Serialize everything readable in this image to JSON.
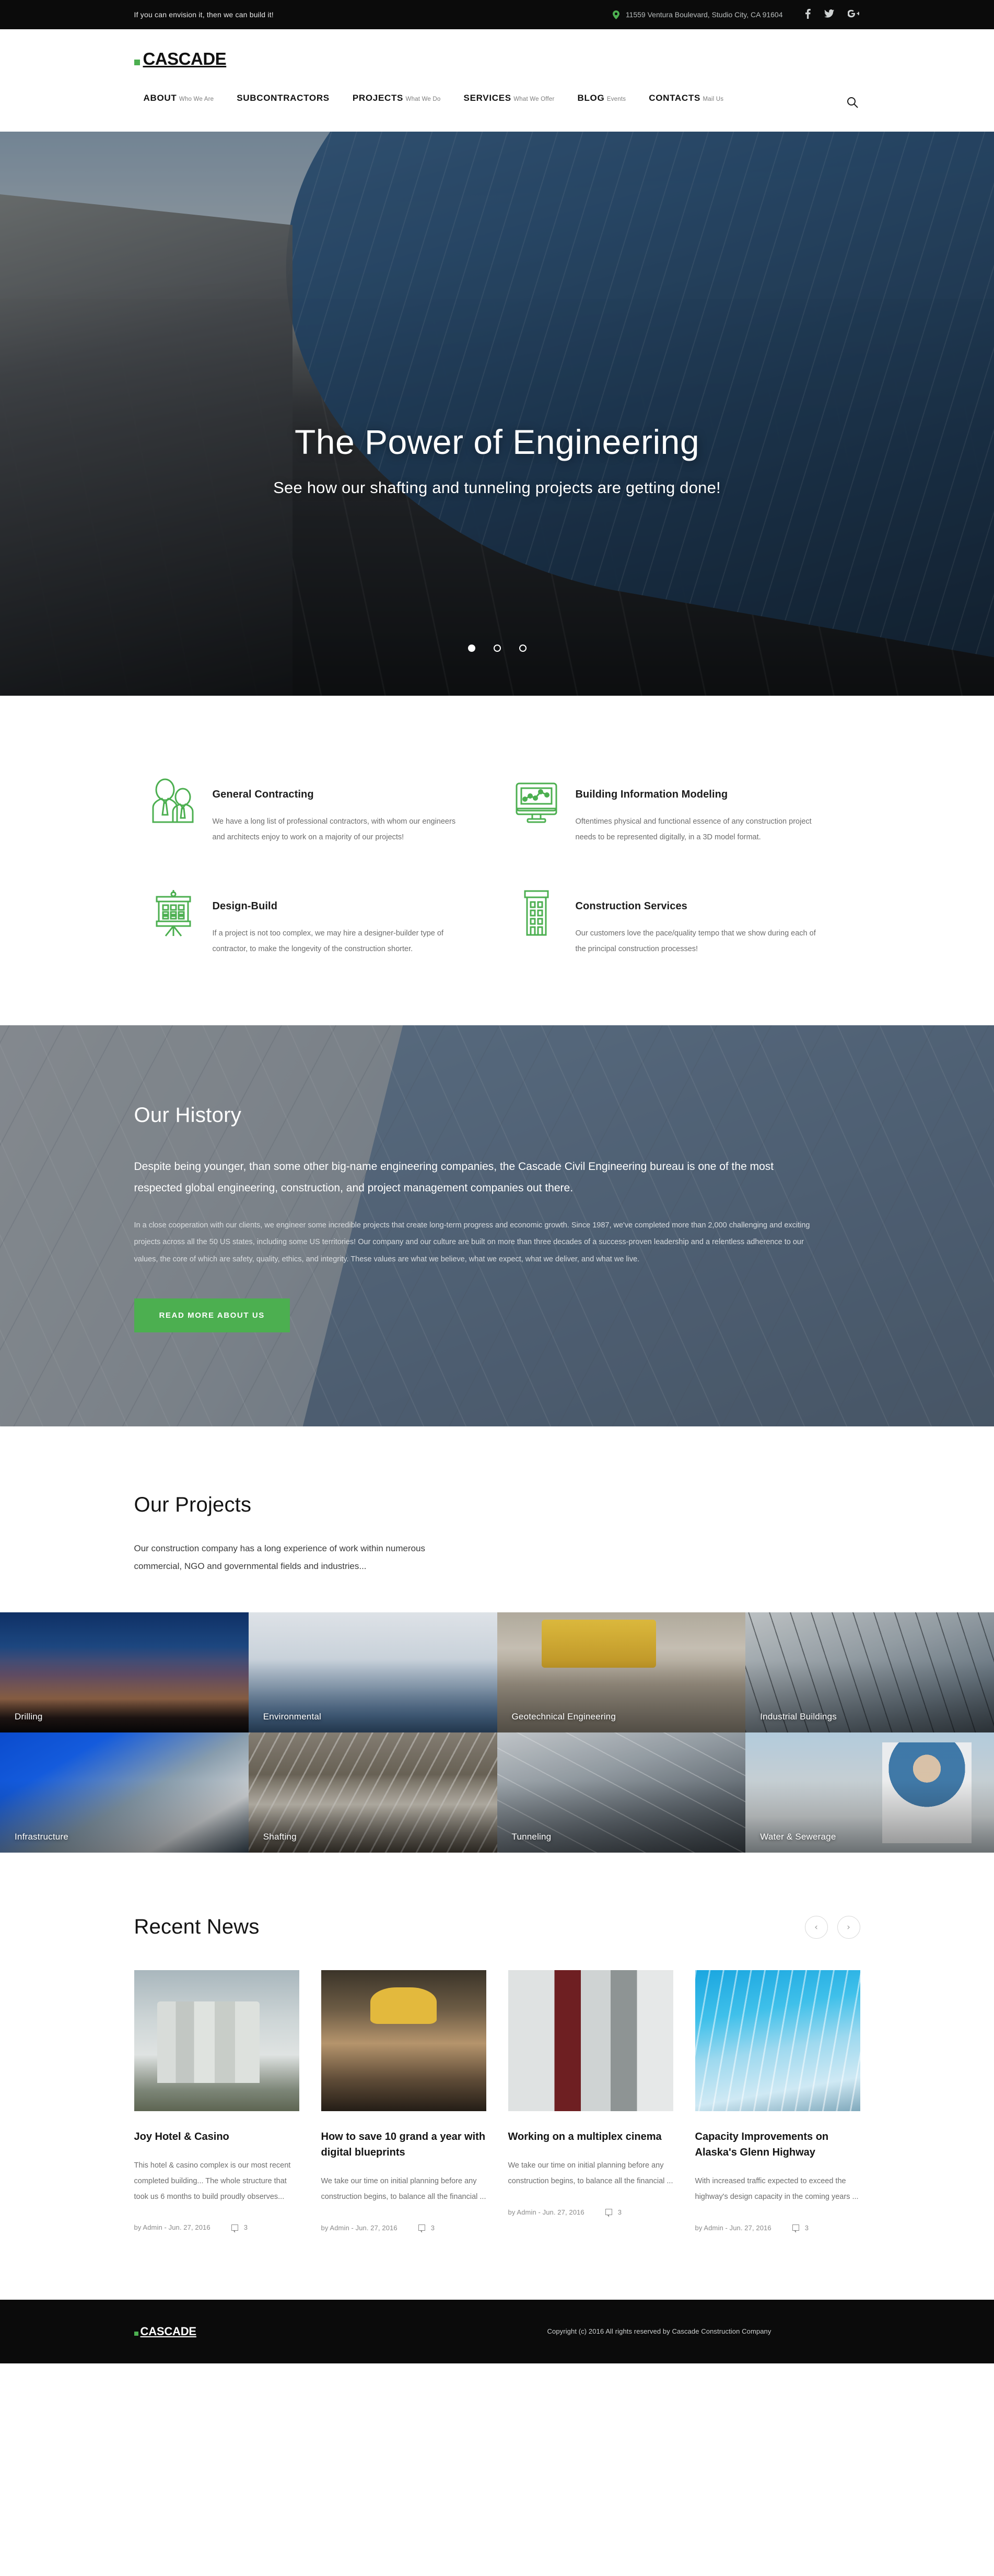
{
  "topbar": {
    "slogan": "If you can envision it, then we can build it!",
    "address": "11559 Ventura Boulevard, Studio City, CA 91604",
    "social": [
      {
        "name": "facebook",
        "glyph": "f"
      },
      {
        "name": "twitter",
        "glyph": "ᵗ"
      },
      {
        "name": "google-plus",
        "glyph": "G+"
      }
    ]
  },
  "header": {
    "logo": "CASCADE",
    "nav": [
      {
        "title": "ABOUT",
        "sub": "Who We Are"
      },
      {
        "title": "SUBCONTRACTORS",
        "sub": ""
      },
      {
        "title": "PROJECTS",
        "sub": "What We Do"
      },
      {
        "title": "SERVICES",
        "sub": "What We Offer"
      },
      {
        "title": "BLOG",
        "sub": "Events"
      },
      {
        "title": "CONTACTS",
        "sub": "Mail Us"
      }
    ],
    "search_icon": "search-icon"
  },
  "hero": {
    "title": "The Power of Engineering",
    "subtitle": "See how our shafting and tunneling projects are getting done!",
    "slides": [
      {
        "active": true
      },
      {
        "active": false
      },
      {
        "active": false
      }
    ]
  },
  "features": [
    {
      "icon": "two-people-icon",
      "title": "General Contracting",
      "desc": "We have a long list of professional contractors, with whom our engineers and architects enjoy to work on a majority of our projects!"
    },
    {
      "icon": "monitor-chart-icon",
      "title": "Building Information Modeling",
      "desc": "Oftentimes physical and functional essence of any construction project needs to be represented digitally, in a 3D model format."
    },
    {
      "icon": "presentation-board-icon",
      "title": "Design-Build",
      "desc": "If a project is not too complex, we may hire a designer-builder type of contractor, to make the longevity of the construction shorter."
    },
    {
      "icon": "building-icon",
      "title": "Construction Services",
      "desc": "Our customers love the pace/quality tempo that we show during each of the principal construction processes!"
    }
  ],
  "history": {
    "title": "Our History",
    "lead": "Despite being younger, than some other big-name engineering companies, the Cascade Civil Engineering bureau is one of the most respected global engineering, construction, and project management companies out there.",
    "body": "In a close cooperation with our clients, we engineer some incredible projects that create long-term progress and economic growth. Since 1987, we've completed more than 2,000 challenging and exciting projects across all the 50 US states, including some US territories! Our company and our culture are built on more than three decades of a success-proven leadership and a relentless adherence to our values, the core of which are safety, quality, ethics, and integrity. These values are what we believe, what we expect, what we deliver, and what we live.",
    "button": "READ MORE ABOUT US"
  },
  "projects": {
    "title": "Our Projects",
    "lead": "Our construction company has a long experience of work within numerous commercial, NGO and governmental fields and industries...",
    "items": [
      {
        "label": "Drilling",
        "photo": "ph-drill"
      },
      {
        "label": "Environmental",
        "photo": "ph-env"
      },
      {
        "label": "Geotechnical Engineering",
        "photo": "ph-geo"
      },
      {
        "label": "Industrial Buildings",
        "photo": "ph-ind"
      },
      {
        "label": "Infrastructure",
        "photo": "ph-infra"
      },
      {
        "label": "Shafting",
        "photo": "ph-shaft"
      },
      {
        "label": "Tunneling",
        "photo": "ph-tun"
      },
      {
        "label": "Water & Sewerage",
        "photo": "ph-water"
      }
    ]
  },
  "news": {
    "title": "Recent News",
    "prev_label": "‹",
    "next_label": "›",
    "items": [
      {
        "thumb": "th-silo",
        "title": "Joy Hotel & Casino",
        "excerpt": "This hotel & casino complex is our most recent completed building... The whole structure that took us 6 months to build proudly observes...",
        "author": "by Admin - Jun. 27, 2016",
        "comments": "3"
      },
      {
        "thumb": "th-worker",
        "title": "How to save 10 grand a year with digital blueprints",
        "excerpt": "We take our time on initial planning before any construction begins, to balance all the financial ...",
        "author": "by Admin - Jun. 27, 2016",
        "comments": "3"
      },
      {
        "thumb": "th-wall",
        "title": "Working on a multiplex cinema",
        "excerpt": "We take our time on initial planning before any construction begins, to balance all the financial ...",
        "author": "by Admin - Jun. 27, 2016",
        "comments": "3"
      },
      {
        "thumb": "th-glass",
        "title": "Capacity Improvements on Alaska's Glenn Highway",
        "excerpt": "With increased traffic expected to exceed the highway's design capacity in the coming years ...",
        "author": "by Admin - Jun. 27, 2016",
        "comments": "3"
      }
    ]
  },
  "footer": {
    "logo": "CASCADE",
    "copyright": "Copyright (c) 2016 All rights reserved by Cascade Construction Company"
  },
  "colors": {
    "accent_green": "#4caf50",
    "dark": "#0b0b0b"
  }
}
